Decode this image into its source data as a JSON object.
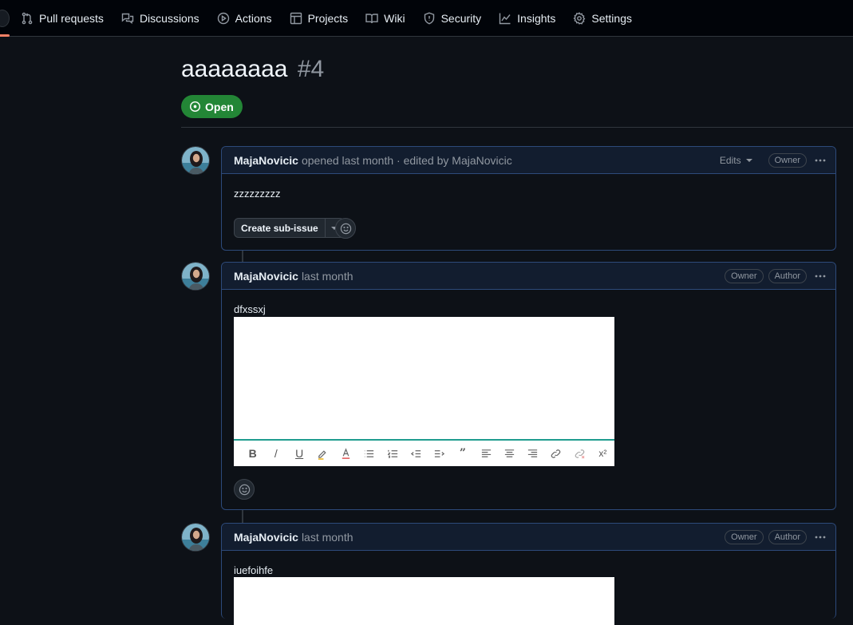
{
  "nav": {
    "items": [
      {
        "label": "Pull requests",
        "icon": "pull-request-icon"
      },
      {
        "label": "Discussions",
        "icon": "discussions-icon"
      },
      {
        "label": "Actions",
        "icon": "play-icon"
      },
      {
        "label": "Projects",
        "icon": "table-icon"
      },
      {
        "label": "Wiki",
        "icon": "book-icon"
      },
      {
        "label": "Security",
        "icon": "shield-icon"
      },
      {
        "label": "Insights",
        "icon": "graph-icon"
      },
      {
        "label": "Settings",
        "icon": "gear-icon"
      }
    ]
  },
  "issue": {
    "title": "aaaaaaaa",
    "number": "#4",
    "state": "Open",
    "state_color": "#238636"
  },
  "comments": [
    {
      "author": "MajaNovicic",
      "meta": "opened last month · edited by MajaNovicic",
      "edits_label": "Edits",
      "roles": [
        "Owner"
      ],
      "body": "zzzzzzzzz",
      "create_subissue_label": "Create sub-issue"
    },
    {
      "author": "MajaNovicic",
      "meta": "last month",
      "roles": [
        "Owner",
        "Author"
      ],
      "body": "dfxssxj"
    },
    {
      "author": "MajaNovicic",
      "meta": "last month",
      "roles": [
        "Owner",
        "Author"
      ],
      "body": "iuefoihfe"
    }
  ],
  "editor_toolbar": {
    "bold": "B",
    "italic": "/",
    "underline": "U",
    "quote": "”",
    "superscript": "x²"
  },
  "colors": {
    "accent_border": "#2d4a7a",
    "header_bg": "#121d2f",
    "editor_toolbar_accent": "#1f9c8f"
  }
}
